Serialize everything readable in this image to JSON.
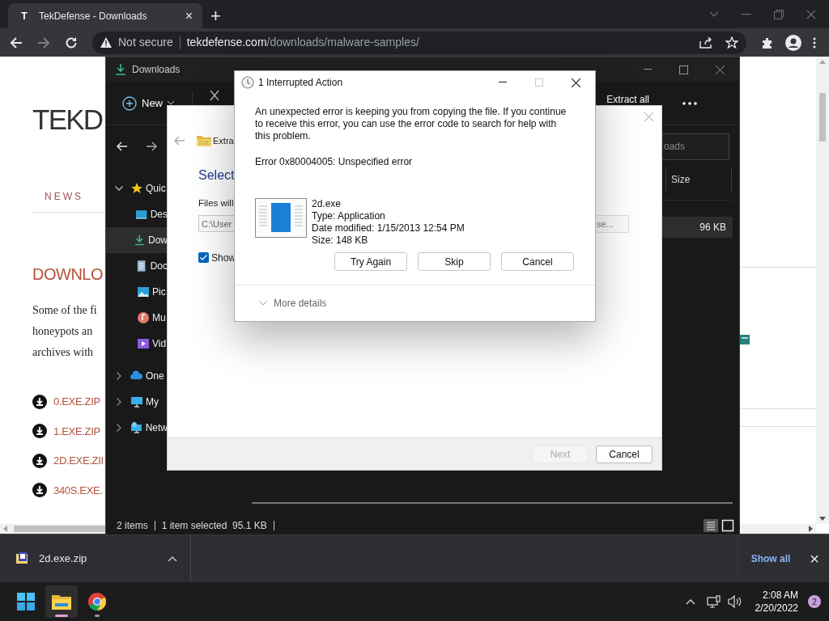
{
  "browser": {
    "tab": {
      "favicon": "T",
      "title": "TekDefense - Downloads",
      "close": "×",
      "selected": true
    },
    "new_tab": "+",
    "address": {
      "security": "Not secure",
      "domain": "tekdefense.com",
      "path": "/downloads/malware-samples/"
    }
  },
  "webpage": {
    "logo": "TEKD",
    "nav": [
      "NEWS"
    ],
    "heading": "DOWNLO",
    "paragraph_lines": [
      "Some of the fi",
      "honeypots an",
      "archives with"
    ],
    "downloads": [
      "0.EXE.ZIP",
      "1.EXE.ZIP",
      "2D.EXE.ZII",
      "340S.EXE."
    ]
  },
  "explorer": {
    "title": "Downloads",
    "new": "New",
    "extract_all": "Extract all",
    "search_placeholder": "oads",
    "columns": [
      "Size"
    ],
    "rows": [
      {
        "size": "96 KB",
        "selected": true
      }
    ],
    "sidebar": [
      {
        "label": "Quic",
        "kind": "star",
        "expanded": true,
        "selected": false,
        "children": [
          {
            "label": "Des",
            "kind": "desktop",
            "selected": false
          },
          {
            "label": "Dow",
            "kind": "download",
            "selected": true
          },
          {
            "label": "Doc",
            "kind": "document",
            "selected": false
          },
          {
            "label": "Pic",
            "kind": "pictures",
            "selected": false
          },
          {
            "label": "Mu",
            "kind": "music",
            "selected": false
          },
          {
            "label": "Vid",
            "kind": "videos",
            "selected": false
          }
        ]
      },
      {
        "label": "One",
        "kind": "cloud",
        "expanded": false,
        "selected": false
      },
      {
        "label": "My",
        "kind": "pc",
        "expanded": false,
        "selected": false
      },
      {
        "label": "Netw",
        "kind": "network",
        "expanded": false,
        "selected": false
      }
    ],
    "status": [
      "2 items",
      "1 item selected  95.1 KB"
    ]
  },
  "extract_wizard": {
    "location": "Extra",
    "heading": "Select",
    "files_label": "Files will",
    "path": "C:\\User",
    "browse": "se...",
    "show_checkbox": {
      "label": "Show",
      "checked": true
    },
    "buttons": [
      {
        "label": "Next",
        "disabled": true
      },
      {
        "label": "Cancel",
        "disabled": false
      }
    ]
  },
  "dialog": {
    "title": "1 Interrupted Action",
    "message": "An unexpected error is keeping you from copying the file. If you continue to receive this error, you can use the error code to search for help with this problem.",
    "error": "Error 0x80004005: Unspecified error",
    "file": {
      "name": "2d.exe",
      "type": "Type: Application",
      "modified": "Date modified: 1/15/2013 12:54 PM",
      "size": "Size: 148 KB"
    },
    "buttons": [
      "Try Again",
      "Skip",
      "Cancel"
    ],
    "more_details": "More details"
  },
  "download_bar": {
    "file": "2d.exe.zip",
    "show_all": "Show all",
    "close": "×"
  },
  "taskbar": {
    "apps": [
      {
        "kind": "start",
        "active": false
      },
      {
        "kind": "explorer",
        "active": true
      },
      {
        "kind": "chrome",
        "active": false
      }
    ],
    "time": "2:08 AM",
    "date": "2/20/2022",
    "notifications": "2"
  }
}
